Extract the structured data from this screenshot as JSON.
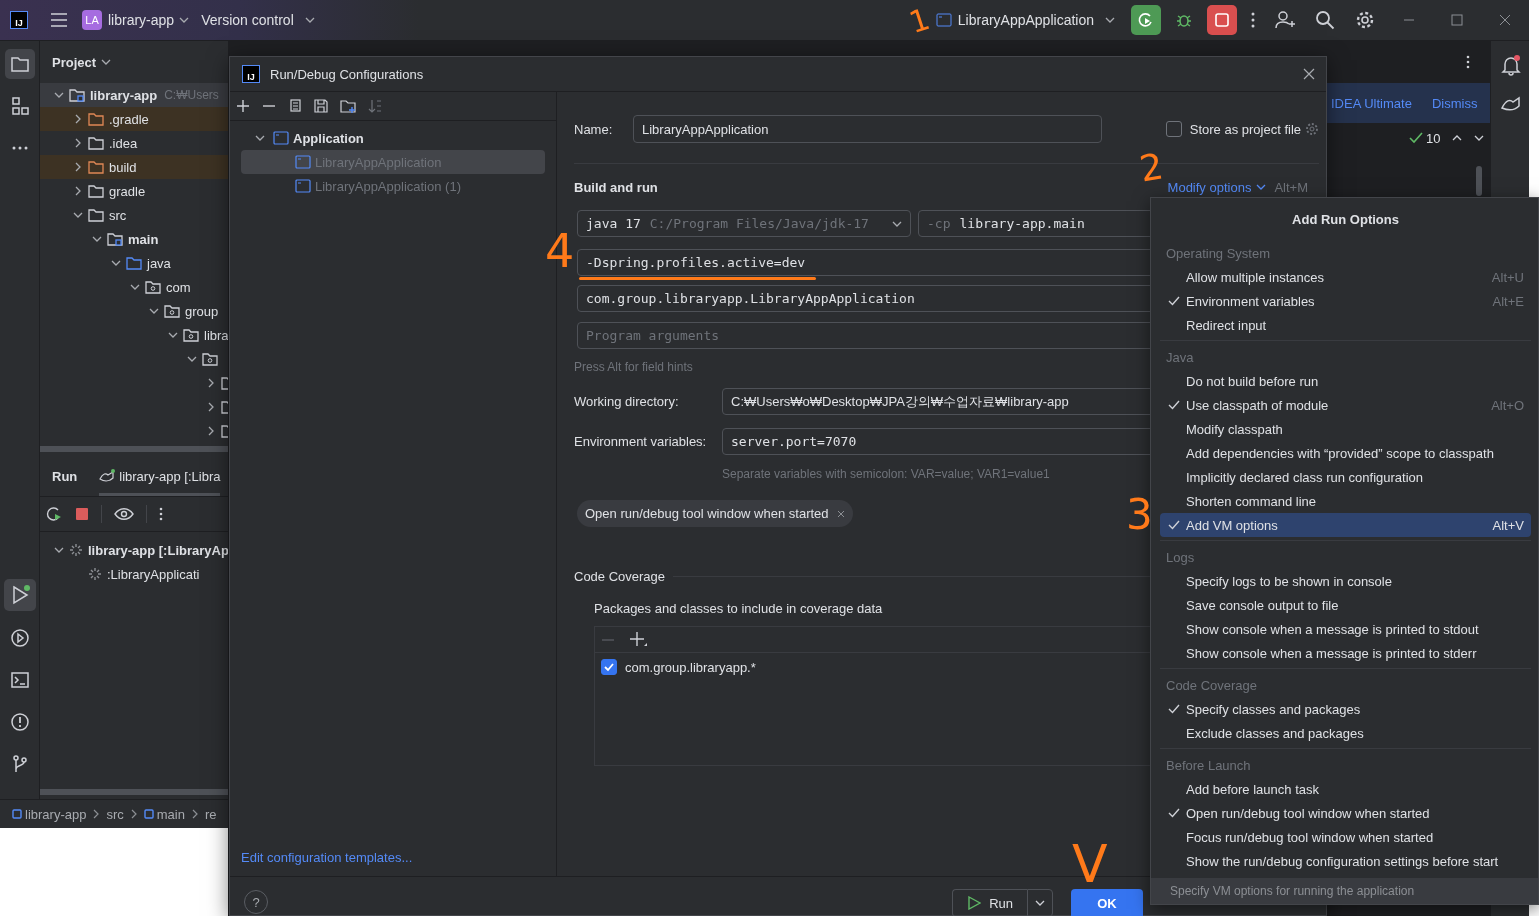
{
  "logo": "IJ",
  "project_switcher": {
    "badge": "LA",
    "name": "library-app"
  },
  "vcs_menu": "Version control",
  "run_config": "LibraryAppApplication",
  "project_panel": {
    "title": "Project",
    "tree": [
      {
        "label": "library-app",
        "path": "C:₩Users",
        "kind": "module",
        "bold": true,
        "expanded": true,
        "selected": true,
        "children": [
          {
            "label": ".gradle",
            "kind": "excluded",
            "expanded": false,
            "selected": false
          },
          {
            "label": ".idea",
            "kind": "folder",
            "expanded": false,
            "selected": false
          },
          {
            "label": "build",
            "kind": "excluded",
            "expanded": false,
            "selected": false
          },
          {
            "label": "gradle",
            "kind": "folder",
            "expanded": false,
            "selected": false
          },
          {
            "label": "src",
            "kind": "folder",
            "expanded": true,
            "selected": false,
            "children": [
              {
                "label": "main",
                "kind": "module",
                "bold": true,
                "expanded": true,
                "selected": false,
                "children": [
                  {
                    "label": "java",
                    "kind": "source",
                    "expanded": true,
                    "selected": false,
                    "children": [
                      {
                        "label": "com",
                        "kind": "package",
                        "expanded": true,
                        "selected": false,
                        "children": [
                          {
                            "label": "group",
                            "kind": "package",
                            "expanded": true,
                            "selected": false,
                            "children": [
                              {
                                "label": "libra",
                                "kind": "package",
                                "expanded": true,
                                "selected": false,
                                "children": [
                                  {
                                    "kind": "package",
                                    "expanded": true,
                                    "selected": false,
                                    "children": [
                                      {
                                        "expanded": false,
                                        "selected": false
                                      },
                                      {
                                        "expanded": false,
                                        "selected": false
                                      },
                                      {
                                        "expanded": false,
                                        "selected": false
                                      }
                                    ]
                                  }
                                ]
                              }
                            ]
                          }
                        ]
                      }
                    ]
                  }
                ]
              }
            ]
          }
        ]
      }
    ]
  },
  "run_panel": {
    "title": "Run",
    "tabs": [
      {
        "label": "library-app [:Libra",
        "selected": true
      }
    ],
    "tree": [
      {
        "label": "library-app [:LibraryAp",
        "bold": true,
        "expanded": true,
        "children": [
          {
            "label": ":LibraryApplicati"
          }
        ]
      }
    ]
  },
  "breadcrumb": [
    {
      "label": "library-app",
      "kind": "module"
    },
    {
      "label": "src",
      "kind": "folder"
    },
    {
      "label": "main",
      "kind": "module"
    },
    {
      "label": "re",
      "kind": "folder"
    }
  ],
  "notification": {
    "link": "IDEA Ultimate",
    "dismiss": "Dismiss"
  },
  "inspections": {
    "count": "10"
  },
  "dialog": {
    "logo": "IJ",
    "title": "Run/Debug Configurations",
    "config_tree": [
      {
        "label": "Application",
        "expanded": true,
        "children": [
          {
            "label": "LibraryAppApplication",
            "selected": true
          },
          {
            "label": "LibraryAppApplication (1)",
            "selected": false
          }
        ]
      }
    ],
    "edit_templates": "Edit configuration templates...",
    "form": {
      "name_label": "Name:",
      "name": "LibraryAppApplication",
      "store": {
        "label": "Store as project file",
        "checked": false
      },
      "section": "Build and run",
      "modify": "Modify options",
      "modify_shortcut": "Alt+M",
      "jre": {
        "version": "java 17",
        "path": "C:/Program Files/Java/jdk-17"
      },
      "classpath": {
        "flag": "-cp",
        "module": "library-app.main"
      },
      "vm_options": "-Dspring.profiles.active=dev",
      "main_class": "com.group.libraryapp.LibraryAppApplication",
      "program_args": {
        "placeholder": "Program arguments"
      },
      "hint": "Press Alt for field hints",
      "working_dir": {
        "label": "Working directory:",
        "value": "C:₩Users₩o₩Desktop₩JPA강의₩수업자료₩library-app"
      },
      "env": {
        "label": "Environment variables:",
        "value": "server.port=7070",
        "hint": "Separate variables with semicolon: VAR=value; VAR1=value1"
      },
      "chips": [
        "Open run/debug tool window when started"
      ],
      "coverage": {
        "title": "Code Coverage",
        "label": "Packages and classes to include in coverage data",
        "patterns": [
          {
            "label": "com.group.libraryapp.*",
            "checked": true
          }
        ]
      }
    },
    "buttons": {
      "help": "?",
      "run": "Run",
      "ok": "OK"
    }
  },
  "run_options": {
    "title": "Add Run Options",
    "groups": [
      {
        "label": "Operating System",
        "items": [
          {
            "label": "Allow multiple instances",
            "checked": false,
            "selected": false,
            "shortcut": "Alt+U"
          },
          {
            "label": "Environment variables",
            "checked": true,
            "selected": false,
            "shortcut": "Alt+E"
          },
          {
            "label": "Redirect input",
            "checked": false,
            "selected": false
          }
        ]
      },
      {
        "label": "Java",
        "items": [
          {
            "label": "Do not build before run",
            "checked": false,
            "selected": false
          },
          {
            "label": "Use classpath of module",
            "checked": true,
            "selected": false,
            "shortcut": "Alt+O"
          },
          {
            "label": "Modify classpath",
            "checked": false,
            "selected": false
          },
          {
            "label": "Add dependencies with “provided” scope to classpath",
            "checked": false,
            "selected": false
          },
          {
            "label": "Implicitly declared class run configuration",
            "checked": false,
            "selected": false
          },
          {
            "label": "Shorten command line",
            "checked": false,
            "selected": false
          },
          {
            "label": "Add VM options",
            "checked": true,
            "selected": true,
            "shortcut": "Alt+V"
          }
        ]
      },
      {
        "label": "Logs",
        "items": [
          {
            "label": "Specify logs to be shown in console",
            "checked": false,
            "selected": false
          },
          {
            "label": "Save console output to file",
            "checked": false,
            "selected": false
          },
          {
            "label": "Show console when a message is printed to stdout",
            "checked": false,
            "selected": false
          },
          {
            "label": "Show console when a message is printed to stderr",
            "checked": false,
            "selected": false
          }
        ]
      },
      {
        "label": "Code Coverage",
        "items": [
          {
            "label": "Specify classes and packages",
            "checked": true,
            "selected": false
          },
          {
            "label": "Exclude classes and packages",
            "checked": false,
            "selected": false
          }
        ]
      },
      {
        "label": "Before Launch",
        "items": [
          {
            "label": "Add before launch task",
            "checked": false,
            "selected": false
          },
          {
            "label": "Open run/debug tool window when started",
            "checked": true,
            "selected": false
          },
          {
            "label": "Focus run/debug tool window when started",
            "checked": false,
            "selected": false
          },
          {
            "label": "Show the run/debug configuration settings before start",
            "checked": false,
            "selected": false
          }
        ]
      }
    ],
    "footer": "Specify VM options for running the application"
  },
  "annotations": [
    {
      "label": "1"
    },
    {
      "label": "2"
    },
    {
      "label": "4"
    },
    {
      "label": "3"
    },
    {
      "label": "V"
    }
  ]
}
